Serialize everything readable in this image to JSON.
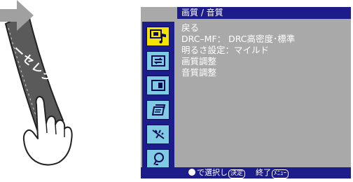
{
  "illustration": {
    "remote_label": "ーセレクト",
    "arrow_color": "#a0a0a0"
  },
  "menu": {
    "title": "画質 / 音質",
    "items": [
      "戻る",
      "DRC–MF：  DRC高密度･標準",
      "明るさ設定：マイルド",
      "画質調整",
      "音質調整"
    ],
    "side_icons": [
      {
        "icon": "picture-sound-icon",
        "active": true
      },
      {
        "icon": "input-select-icon",
        "active": false
      },
      {
        "icon": "screen-mode-icon",
        "active": false
      },
      {
        "icon": "setup-icon",
        "active": false
      },
      {
        "icon": "antenna-icon",
        "active": false
      },
      {
        "icon": "light-bulb-icon",
        "active": false
      }
    ]
  },
  "footer": {
    "select_text": "で選択し",
    "select_key": "決定",
    "exit_text": "終了",
    "exit_key": "ﾒﾆｭｰ"
  },
  "colors": {
    "menu_bg": "#a9a9a9",
    "bar": "#1c1c8a",
    "icon_bg": "#7fcbe3",
    "icon_active": "#f5e400"
  }
}
